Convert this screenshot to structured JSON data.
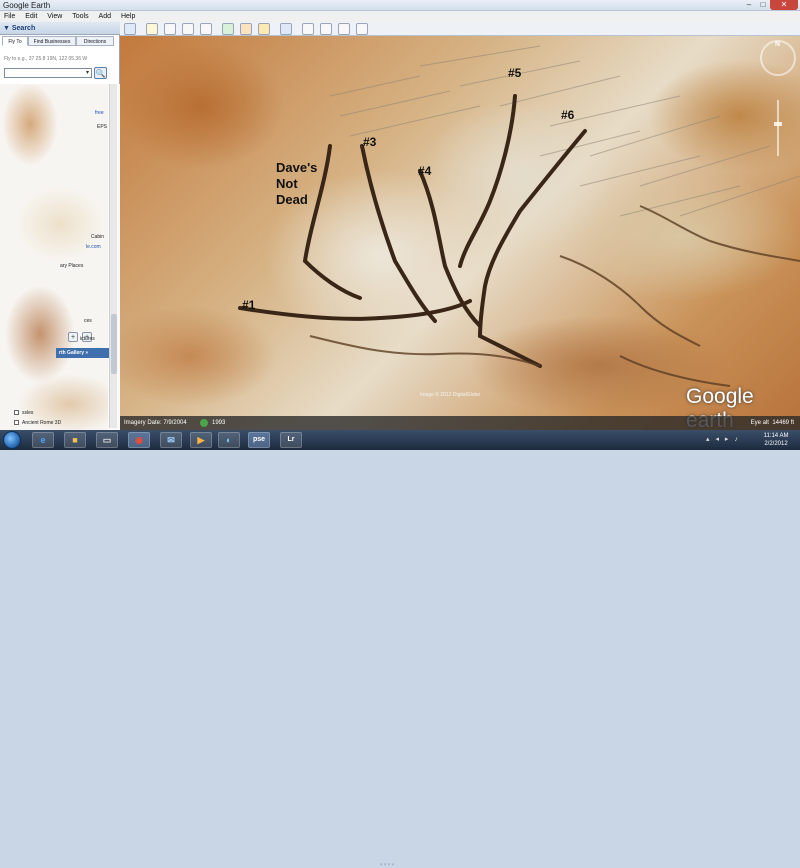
{
  "window": {
    "title": "Google Earth",
    "min": "–",
    "max": "□",
    "close": "✕"
  },
  "menu": [
    "File",
    "Edit",
    "View",
    "Tools",
    "Add",
    "Help"
  ],
  "toolbar": {
    "buttons": [
      "sidebar-icon",
      "placemark-icon",
      "polygon-icon",
      "path-icon",
      "image-overlay-icon",
      "record-tour-icon",
      "historical-imagery-icon",
      "sunlight-icon",
      "planets-icon",
      "ruler-icon",
      "email-icon",
      "print-icon",
      "save-image-icon"
    ]
  },
  "search": {
    "header": "▼ Search",
    "tabs": [
      "Fly To",
      "Find Businesses",
      "Directions"
    ],
    "fly_to_hint": "Fly to e.g., 37 25.8 19N, 122 05.36 W",
    "input_value": "",
    "dropdown_glyph": "▾",
    "go_glyph": "🔍"
  },
  "panel": {
    "fragments": [
      "free",
      "EPS",
      "Cabin",
      "le.com",
      "ary Places",
      "ces",
      "ictures",
      "ssles",
      "Ancient Rome 3D"
    ],
    "gallery_label": "rth Gallery »",
    "nav_left": "+",
    "nav_right": "+"
  },
  "map": {
    "labels": [
      "#1",
      "#3",
      "#4",
      "#5",
      "#6",
      "Dave's",
      "Not",
      "Dead"
    ],
    "copyright": "Image © 2012 DigitalGlobe",
    "logo": "Google earth",
    "compass_n": "N"
  },
  "status": {
    "imagery_date": "Imagery Date: 7/9/2004",
    "year": "1993",
    "eye_alt_label": "Eye alt",
    "eye_alt_value": "14469 ft"
  },
  "taskbar": {
    "items": [
      "ie-icon",
      "explorer-icon",
      "files-icon",
      "outlook-icon",
      "chrome-icon",
      "media-icon",
      "acrobat-icon",
      "google-earth-icon",
      "pse-icon",
      "lr-icon"
    ],
    "labels": {
      "pse": "pse",
      "lr": "Lr"
    },
    "time": "11:14 AM",
    "date": "2/2/2012",
    "bottom_hint": "▾ ▾ ▾ ▾"
  }
}
